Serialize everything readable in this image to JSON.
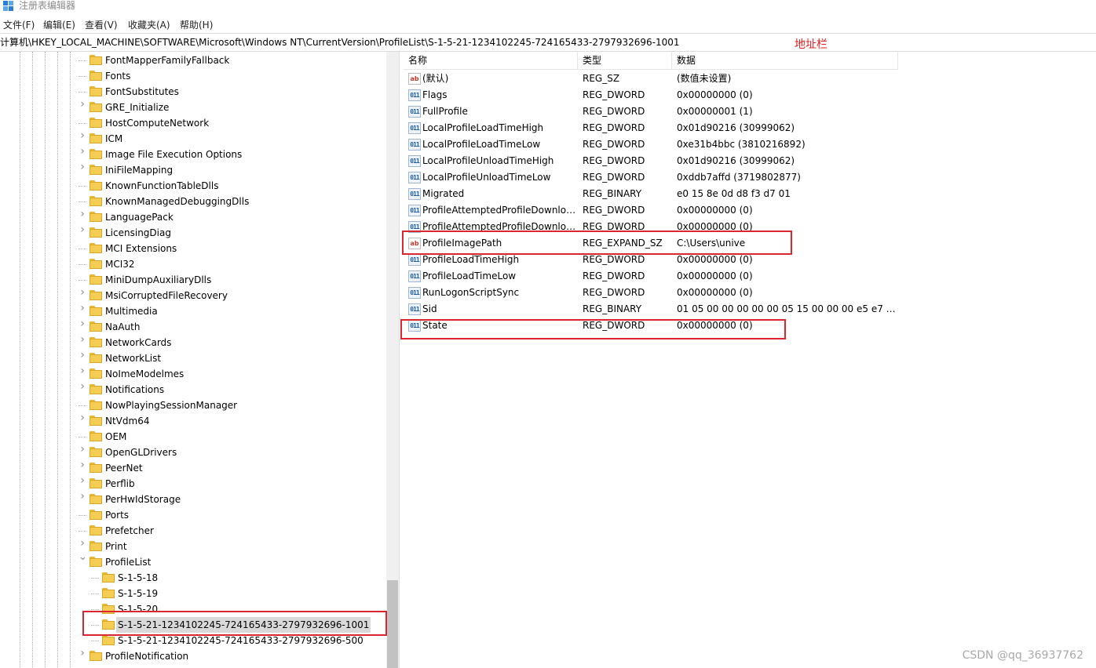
{
  "window": {
    "title": "注册表编辑器",
    "icon": "registry-editor-icon"
  },
  "menu": {
    "items": [
      {
        "label": "文件(F)"
      },
      {
        "label": "编辑(E)"
      },
      {
        "label": "查看(V)"
      },
      {
        "label": "收藏夹(A)"
      },
      {
        "label": "帮助(H)"
      }
    ]
  },
  "address": {
    "path": "计算机\\HKEY_LOCAL_MACHINE\\SOFTWARE\\Microsoft\\Windows NT\\CurrentVersion\\ProfileList\\S-1-5-21-1234102245-724165433-2797932696-1001",
    "annotation": "地址栏"
  },
  "annotation_color": "#d9262f",
  "tree": {
    "items": [
      {
        "label": "FontMapperFamilyFallback",
        "level": 1,
        "expander": "none"
      },
      {
        "label": "Fonts",
        "level": 1,
        "expander": "none"
      },
      {
        "label": "FontSubstitutes",
        "level": 1,
        "expander": "none"
      },
      {
        "label": "GRE_Initialize",
        "level": 1,
        "expander": "collapsed"
      },
      {
        "label": "HostComputeNetwork",
        "level": 1,
        "expander": "none"
      },
      {
        "label": "ICM",
        "level": 1,
        "expander": "collapsed"
      },
      {
        "label": "Image File Execution Options",
        "level": 1,
        "expander": "collapsed"
      },
      {
        "label": "IniFileMapping",
        "level": 1,
        "expander": "collapsed"
      },
      {
        "label": "KnownFunctionTableDlls",
        "level": 1,
        "expander": "none"
      },
      {
        "label": "KnownManagedDebuggingDlls",
        "level": 1,
        "expander": "none"
      },
      {
        "label": "LanguagePack",
        "level": 1,
        "expander": "collapsed"
      },
      {
        "label": "LicensingDiag",
        "level": 1,
        "expander": "collapsed"
      },
      {
        "label": "MCI Extensions",
        "level": 1,
        "expander": "none"
      },
      {
        "label": "MCI32",
        "level": 1,
        "expander": "none"
      },
      {
        "label": "MiniDumpAuxiliaryDlls",
        "level": 1,
        "expander": "none"
      },
      {
        "label": "MsiCorruptedFileRecovery",
        "level": 1,
        "expander": "collapsed"
      },
      {
        "label": "Multimedia",
        "level": 1,
        "expander": "collapsed"
      },
      {
        "label": "NaAuth",
        "level": 1,
        "expander": "collapsed"
      },
      {
        "label": "NetworkCards",
        "level": 1,
        "expander": "collapsed"
      },
      {
        "label": "NetworkList",
        "level": 1,
        "expander": "collapsed"
      },
      {
        "label": "NoImeModelmes",
        "level": 1,
        "expander": "collapsed"
      },
      {
        "label": "Notifications",
        "level": 1,
        "expander": "collapsed"
      },
      {
        "label": "NowPlayingSessionManager",
        "level": 1,
        "expander": "none"
      },
      {
        "label": "NtVdm64",
        "level": 1,
        "expander": "collapsed"
      },
      {
        "label": "OEM",
        "level": 1,
        "expander": "none"
      },
      {
        "label": "OpenGLDrivers",
        "level": 1,
        "expander": "collapsed"
      },
      {
        "label": "PeerNet",
        "level": 1,
        "expander": "collapsed"
      },
      {
        "label": "Perflib",
        "level": 1,
        "expander": "collapsed"
      },
      {
        "label": "PerHwIdStorage",
        "level": 1,
        "expander": "collapsed"
      },
      {
        "label": "Ports",
        "level": 1,
        "expander": "none"
      },
      {
        "label": "Prefetcher",
        "level": 1,
        "expander": "none"
      },
      {
        "label": "Print",
        "level": 1,
        "expander": "collapsed"
      },
      {
        "label": "ProfileList",
        "level": 1,
        "expander": "expanded"
      },
      {
        "label": "S-1-5-18",
        "level": 2,
        "expander": "none"
      },
      {
        "label": "S-1-5-19",
        "level": 2,
        "expander": "none"
      },
      {
        "label": "S-1-5-20",
        "level": 2,
        "expander": "none"
      },
      {
        "label": "S-1-5-21-1234102245-724165433-2797932696-1001",
        "level": 2,
        "expander": "none",
        "selected": true
      },
      {
        "label": "S-1-5-21-1234102245-724165433-2797932696-500",
        "level": 2,
        "expander": "none"
      },
      {
        "label": "ProfileNotification",
        "level": 1,
        "expander": "collapsed"
      }
    ]
  },
  "values": {
    "columns": {
      "name": "名称",
      "type": "类型",
      "data": "数据"
    },
    "rows": [
      {
        "icon": "ab",
        "name": "(默认)",
        "type": "REG_SZ",
        "data": "(数值未设置)"
      },
      {
        "icon": "bin",
        "name": "Flags",
        "type": "REG_DWORD",
        "data": "0x00000000 (0)"
      },
      {
        "icon": "bin",
        "name": "FullProfile",
        "type": "REG_DWORD",
        "data": "0x00000001 (1)"
      },
      {
        "icon": "bin",
        "name": "LocalProfileLoadTimeHigh",
        "type": "REG_DWORD",
        "data": "0x01d90216 (30999062)"
      },
      {
        "icon": "bin",
        "name": "LocalProfileLoadTimeLow",
        "type": "REG_DWORD",
        "data": "0xe31b4bbc (3810216892)"
      },
      {
        "icon": "bin",
        "name": "LocalProfileUnloadTimeHigh",
        "type": "REG_DWORD",
        "data": "0x01d90216 (30999062)"
      },
      {
        "icon": "bin",
        "name": "LocalProfileUnloadTimeLow",
        "type": "REG_DWORD",
        "data": "0xddb7affd (3719802877)"
      },
      {
        "icon": "bin",
        "name": "Migrated",
        "type": "REG_BINARY",
        "data": "e0 15 8e 0d d8 f3 d7 01"
      },
      {
        "icon": "bin",
        "name": "ProfileAttemptedProfileDownloa...",
        "type": "REG_DWORD",
        "data": "0x00000000 (0)"
      },
      {
        "icon": "bin",
        "name": "ProfileAttemptedProfileDownloa...",
        "type": "REG_DWORD",
        "data": "0x00000000 (0)"
      },
      {
        "icon": "ab",
        "name": "ProfileImagePath",
        "type": "REG_EXPAND_SZ",
        "data": "C:\\Users\\unive",
        "highlighted": true
      },
      {
        "icon": "bin",
        "name": "ProfileLoadTimeHigh",
        "type": "REG_DWORD",
        "data": "0x00000000 (0)"
      },
      {
        "icon": "bin",
        "name": "ProfileLoadTimeLow",
        "type": "REG_DWORD",
        "data": "0x00000000 (0)"
      },
      {
        "icon": "bin",
        "name": "RunLogonScriptSync",
        "type": "REG_DWORD",
        "data": "0x00000000 (0)"
      },
      {
        "icon": "bin",
        "name": "Sid",
        "type": "REG_BINARY",
        "data": "01 05 00 00 00 00 00 05 15 00 00 00 e5 e7 8e..."
      },
      {
        "icon": "bin",
        "name": "State",
        "type": "REG_DWORD",
        "data": "0x00000000 (0)",
        "highlighted": true
      }
    ]
  },
  "watermark": "CSDN @qq_36937762"
}
